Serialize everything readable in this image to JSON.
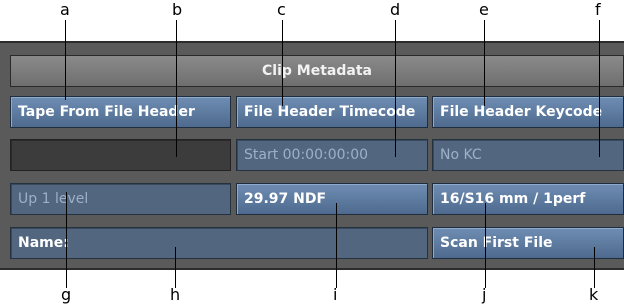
{
  "callouts": {
    "a": "a",
    "b": "b",
    "c": "c",
    "d": "d",
    "e": "e",
    "f": "f",
    "g": "g",
    "h": "h",
    "i": "i",
    "j": "j",
    "k": "k"
  },
  "panel": {
    "title": "Clip Metadata",
    "tape_button": "Tape From File Header",
    "timecode_button": "File Header Timecode",
    "keycode_button": "File Header Keycode",
    "tape_field_value": "",
    "start_field_value": "Start 00:00:00:00",
    "kc_field_value": "No KC",
    "level_field_value": "Up 1 level",
    "framerate_value": "29.97 NDF",
    "filmformat_value": "16/S16 mm / 1perf",
    "name_field_label": "Name:",
    "scan_button": "Scan First File"
  }
}
